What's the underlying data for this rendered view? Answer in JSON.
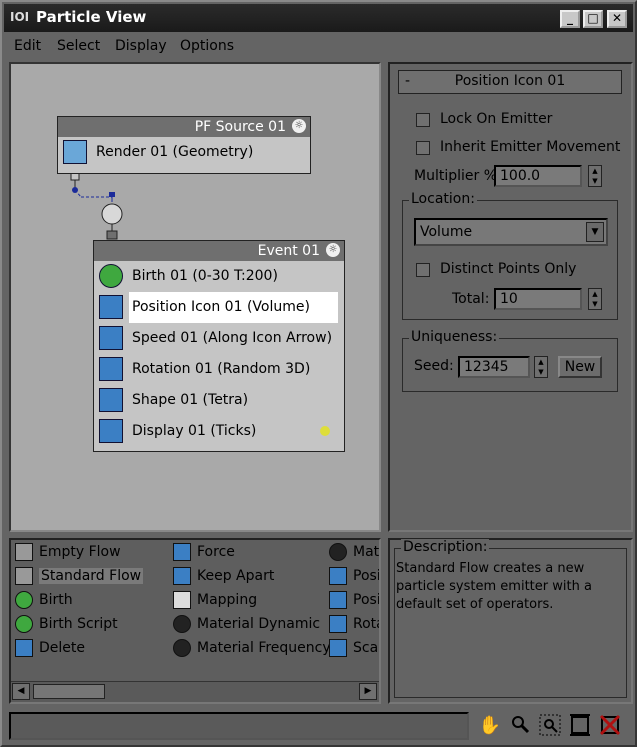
{
  "window": {
    "title": "Particle View",
    "app_icon": "IOI",
    "minimize": "_",
    "maximize": "□",
    "close": "✕"
  },
  "menu": [
    "Edit",
    "Select",
    "Display",
    "Options"
  ],
  "source_node": {
    "header": "PF Source 01",
    "operator": "Render 01 (Geometry)"
  },
  "event_node": {
    "header": "Event 01",
    "operators": [
      {
        "label": "Birth 01 (0-30 T:200)",
        "icon": "birth-icon",
        "color": "#3fa83f"
      },
      {
        "label": "Position Icon 01 (Volume)",
        "icon": "position-icon",
        "color": "#3b7fc4"
      },
      {
        "label": "Speed 01 (Along Icon Arrow)",
        "icon": "speed-icon",
        "color": "#3b7fc4"
      },
      {
        "label": "Rotation 01 (Random 3D)",
        "icon": "rotation-icon",
        "color": "#3b7fc4"
      },
      {
        "label": "Shape 01 (Tetra)",
        "icon": "shape-icon",
        "color": "#3b7fc4"
      },
      {
        "label": "Display 01 (Ticks)",
        "icon": "display-icon",
        "color": "#3b7fc4"
      }
    ]
  },
  "params": {
    "rollout_title": "Position Icon 01",
    "rollout_minus": "-",
    "lock_on_emitter": "Lock On Emitter",
    "inherit_emitter_movement": "Inherit Emitter Movement",
    "multiplier_label": "Multiplier %",
    "multiplier_value": "100.0",
    "location_group": "Location:",
    "location_value": "Volume",
    "distinct_points_only": "Distinct Points Only",
    "total_label": "Total:",
    "total_value": "10",
    "uniqueness_group": "Uniqueness:",
    "seed_label": "Seed:",
    "seed_value": "12345",
    "new_button": "New"
  },
  "depot": {
    "col1": [
      {
        "label": "Empty Flow",
        "icon": "flow-icon"
      },
      {
        "label": "Standard Flow",
        "icon": "flow-icon",
        "highlight": true
      },
      {
        "label": "Birth",
        "icon": "birth-icon"
      },
      {
        "label": "Birth Script",
        "icon": "birth-script-icon"
      },
      {
        "label": "Delete",
        "icon": "delete-icon"
      }
    ],
    "col2": [
      {
        "label": "Force",
        "icon": "force-icon"
      },
      {
        "label": "Keep Apart",
        "icon": "keep-apart-icon"
      },
      {
        "label": "Mapping",
        "icon": "mapping-icon"
      },
      {
        "label": "Material Dynamic",
        "icon": "material-icon"
      },
      {
        "label": "Material Frequency",
        "icon": "material-icon"
      }
    ],
    "col3": [
      {
        "label": "Mate",
        "icon": "material-icon"
      },
      {
        "label": "Posi",
        "icon": "position-icon"
      },
      {
        "label": "Posi",
        "icon": "position-icon"
      },
      {
        "label": "Rota",
        "icon": "rotation-icon"
      },
      {
        "label": "Sca",
        "icon": "scale-icon"
      }
    ]
  },
  "description": {
    "label": "Description:",
    "text": "Standard Flow creates a new particle system emitter with a default set of operators."
  },
  "nav_icons": [
    "pan-icon",
    "zoom-icon",
    "zoom-region-icon",
    "zoom-extents-icon",
    "no-zoom-icon"
  ]
}
